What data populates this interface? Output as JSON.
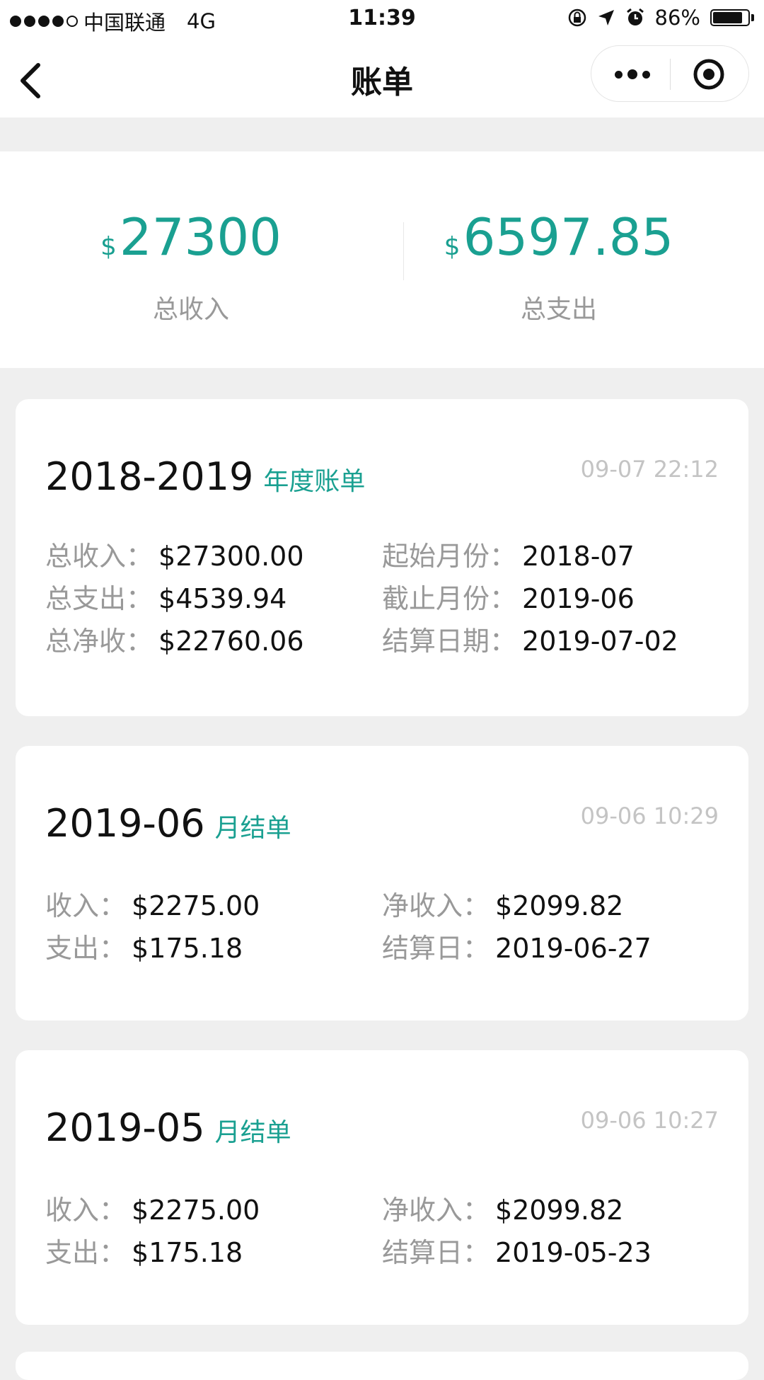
{
  "status_bar": {
    "carrier": "中国联通",
    "network": "4G",
    "time": "11:39",
    "battery": "86%",
    "battery_level": 0.86
  },
  "nav": {
    "title": "账单"
  },
  "summary": {
    "currency": "$",
    "income_amount": "27300",
    "income_label": "总收入",
    "expense_amount": "6597.85",
    "expense_label": "总支出"
  },
  "cards": [
    {
      "period": "2018-2019",
      "type": "年度账单",
      "time": "09-07 22:12",
      "rows": [
        {
          "l_label": "总收入：",
          "l_value": "$27300.00",
          "r_label": "起始月份：",
          "r_value": "2018-07"
        },
        {
          "l_label": "总支出：",
          "l_value": "$4539.94",
          "r_label": "截止月份：",
          "r_value": "2019-06"
        },
        {
          "l_label": "总净收：",
          "l_value": "$22760.06",
          "r_label": "结算日期：",
          "r_value": "2019-07-02"
        }
      ]
    },
    {
      "period": "2019-06",
      "type": "月结单",
      "time": "09-06 10:29",
      "rows": [
        {
          "l_label": "收入：",
          "l_value": "$2275.00",
          "r_label": "净收入：",
          "r_value": "$2099.82"
        },
        {
          "l_label": "支出：",
          "l_value": "$175.18",
          "r_label": "结算日：",
          "r_value": "2019-06-27"
        }
      ]
    },
    {
      "period": "2019-05",
      "type": "月结单",
      "time": "09-06 10:27",
      "rows": [
        {
          "l_label": "收入：",
          "l_value": "$2275.00",
          "r_label": "净收入：",
          "r_value": "$2099.82"
        },
        {
          "l_label": "支出：",
          "l_value": "$175.18",
          "r_label": "结算日：",
          "r_value": "2019-05-23"
        }
      ]
    }
  ],
  "icons": {
    "back": "chevron-left-icon",
    "more": "more-dots-icon",
    "close": "target-circle-icon",
    "lock": "orientation-lock-icon",
    "location": "location-arrow-icon",
    "alarm": "alarm-clock-icon",
    "battery": "battery-icon"
  },
  "colors": {
    "accent": "#1aa091",
    "muted_text": "#999999",
    "time_text": "#c4c4c4",
    "page_bg": "#efefef"
  }
}
